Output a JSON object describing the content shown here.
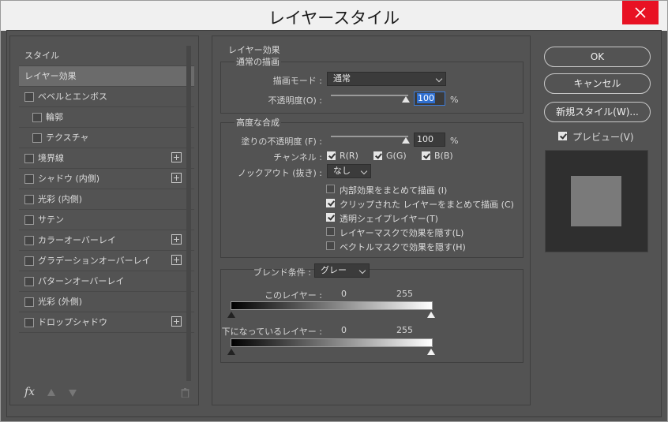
{
  "window": {
    "title": "レイヤースタイル"
  },
  "styles_panel": {
    "items": [
      {
        "label": "スタイル",
        "checkbox": false,
        "checked": false,
        "plus": false,
        "selected": false,
        "indent": false
      },
      {
        "label": "レイヤー効果",
        "checkbox": false,
        "checked": false,
        "plus": false,
        "selected": true,
        "indent": false
      },
      {
        "label": "ベベルとエンボス",
        "checkbox": true,
        "checked": false,
        "plus": false,
        "selected": false,
        "indent": false
      },
      {
        "label": "輪郭",
        "checkbox": true,
        "checked": false,
        "plus": false,
        "selected": false,
        "indent": true
      },
      {
        "label": "テクスチャ",
        "checkbox": true,
        "checked": false,
        "plus": false,
        "selected": false,
        "indent": true
      },
      {
        "label": "境界線",
        "checkbox": true,
        "checked": false,
        "plus": true,
        "selected": false,
        "indent": false
      },
      {
        "label": "シャドウ (内側)",
        "checkbox": true,
        "checked": false,
        "plus": true,
        "selected": false,
        "indent": false
      },
      {
        "label": "光彩 (内側)",
        "checkbox": true,
        "checked": false,
        "plus": false,
        "selected": false,
        "indent": false
      },
      {
        "label": "サテン",
        "checkbox": true,
        "checked": false,
        "plus": false,
        "selected": false,
        "indent": false
      },
      {
        "label": "カラーオーバーレイ",
        "checkbox": true,
        "checked": false,
        "plus": true,
        "selected": false,
        "indent": false
      },
      {
        "label": "グラデーションオーバーレイ",
        "checkbox": true,
        "checked": false,
        "plus": true,
        "selected": false,
        "indent": false
      },
      {
        "label": "パターンオーバーレイ",
        "checkbox": true,
        "checked": false,
        "plus": false,
        "selected": false,
        "indent": false
      },
      {
        "label": "光彩 (外側)",
        "checkbox": true,
        "checked": false,
        "plus": false,
        "selected": false,
        "indent": false
      },
      {
        "label": "ドロップシャドウ",
        "checkbox": true,
        "checked": false,
        "plus": true,
        "selected": false,
        "indent": false
      }
    ],
    "footer": {
      "fx_label": "fx"
    }
  },
  "layer_effects": {
    "section_title": "レイヤー効果",
    "normal": {
      "title": "通常の描画",
      "blend_mode_label": "描画モード :",
      "blend_mode_value": "通常",
      "opacity_label": "不透明度(O) :",
      "opacity_value": "100",
      "opacity_unit": "%",
      "opacity_level": 1.0
    },
    "advanced": {
      "title": "高度な合成",
      "fill_opacity_label": "塗りの不透明度 (F) :",
      "fill_opacity_value": "100",
      "fill_opacity_unit": "%",
      "fill_opacity_level": 1.0,
      "channels_label": "チャンネル :",
      "channels": [
        {
          "label": "R(R)",
          "checked": true
        },
        {
          "label": "G(G)",
          "checked": true
        },
        {
          "label": "B(B)",
          "checked": true
        }
      ],
      "knockout_label": "ノックアウト (抜き) :",
      "knockout_value": "なし",
      "options": [
        {
          "label": "内部効果をまとめて描画 (I)",
          "checked": false
        },
        {
          "label": "クリップされた レイヤーをまとめて描画 (C)",
          "checked": true
        },
        {
          "label": "透明シェイプレイヤー(T)",
          "checked": true
        },
        {
          "label": "レイヤーマスクで効果を隠す(L)",
          "checked": false
        },
        {
          "label": "ベクトルマスクで効果を隠す(H)",
          "checked": false
        }
      ]
    },
    "blend_if": {
      "label": "ブレンド条件 :",
      "value": "グレー",
      "this_layer_label": "このレイヤー :",
      "this_layer_min": "0",
      "this_layer_max": "255",
      "underlying_label": "下になっているレイヤー :",
      "underlying_min": "0",
      "underlying_max": "255"
    }
  },
  "actions": {
    "ok_label": "OK",
    "cancel_label": "キャンセル",
    "new_style_label": "新規スタイル(W)...",
    "preview_label": "プレビュー(V)",
    "preview_checked": true
  },
  "colors": {
    "dialog_bg": "#535353",
    "selected_row": "#6b6b6b",
    "close_button": "#e81123",
    "focus_highlight": "#2f6fd0"
  }
}
